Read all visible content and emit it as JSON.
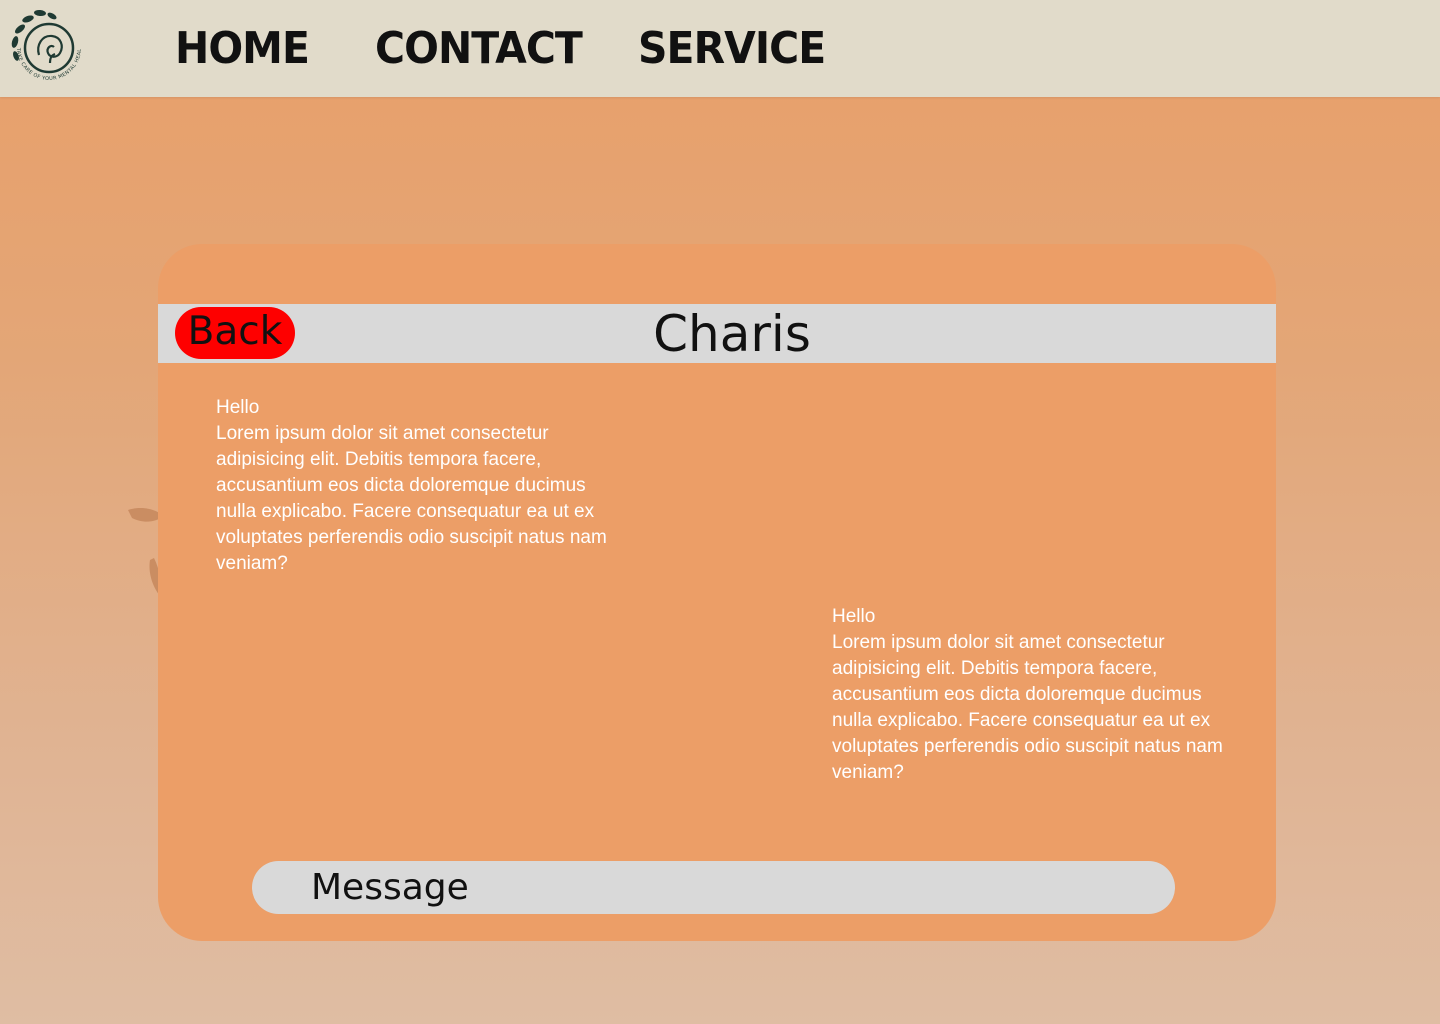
{
  "nav": {
    "logo_icon": "mental-health-leaf-logo-icon",
    "logo_text": "TAKE CARE OF YOUR MENTAL HEALTH",
    "links": [
      "HOME",
      "CONTACT",
      "SERVICE"
    ]
  },
  "chat": {
    "back_label": "Back",
    "contact_name": "Charis",
    "messages": [
      {
        "side": "left",
        "greeting": "Hello",
        "body": "Lorem ipsum dolor sit amet consectetur adipisicing elit. Debitis tempora facere, accusantium eos dicta doloremque ducimus nulla explicabo. Facere consequatur ea ut ex voluptates perferendis odio suscipit natus nam veniam?"
      },
      {
        "side": "right",
        "greeting": "Hello",
        "body": "Lorem ipsum dolor sit amet consectetur adipisicing elit. Debitis tempora facere, accusantium eos dicta doloremque ducimus nulla explicabo. Facere consequatur ea ut ex voluptates perferendis odio suscipit natus nam veniam?"
      }
    ],
    "input_placeholder": "Message"
  },
  "colors": {
    "navbar_bg": "#e1dbca",
    "card_bg": "#ec9e67",
    "header_bg": "#d9d9d9",
    "back_button": "#fe0000",
    "message_text": "#ffffff"
  }
}
